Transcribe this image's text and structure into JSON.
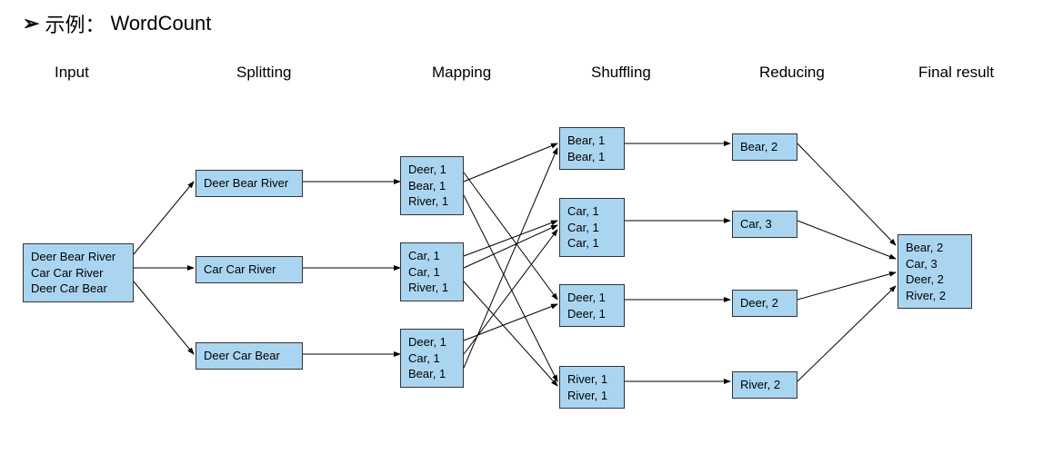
{
  "title": {
    "bullet": "➢",
    "prefix": "示例：",
    "name": "WordCount"
  },
  "headers": {
    "input": "Input",
    "splitting": "Splitting",
    "mapping": "Mapping",
    "shuffling": "Shuffling",
    "reducing": "Reducing",
    "final": "Final result"
  },
  "input": {
    "lines": "Deer Bear River\nCar Car River\nDeer Car Bear"
  },
  "splitting": {
    "s1": "Deer Bear River",
    "s2": "Car Car River",
    "s3": "Deer Car Bear"
  },
  "mapping": {
    "m1": "Deer, 1\nBear, 1\nRiver, 1",
    "m2": "Car, 1\nCar, 1\nRiver, 1",
    "m3": "Deer, 1\nCar, 1\nBear, 1"
  },
  "shuffling": {
    "sh1": "Bear, 1\nBear, 1",
    "sh2": "Car, 1\nCar, 1\nCar, 1",
    "sh3": "Deer, 1\nDeer, 1",
    "sh4": "River, 1\nRiver, 1"
  },
  "reducing": {
    "r1": "Bear, 2",
    "r2": "Car, 3",
    "r3": "Deer, 2",
    "r4": "River, 2"
  },
  "final": {
    "lines": "Bear, 2\nCar, 3\nDeer, 2\nRiver, 2"
  }
}
